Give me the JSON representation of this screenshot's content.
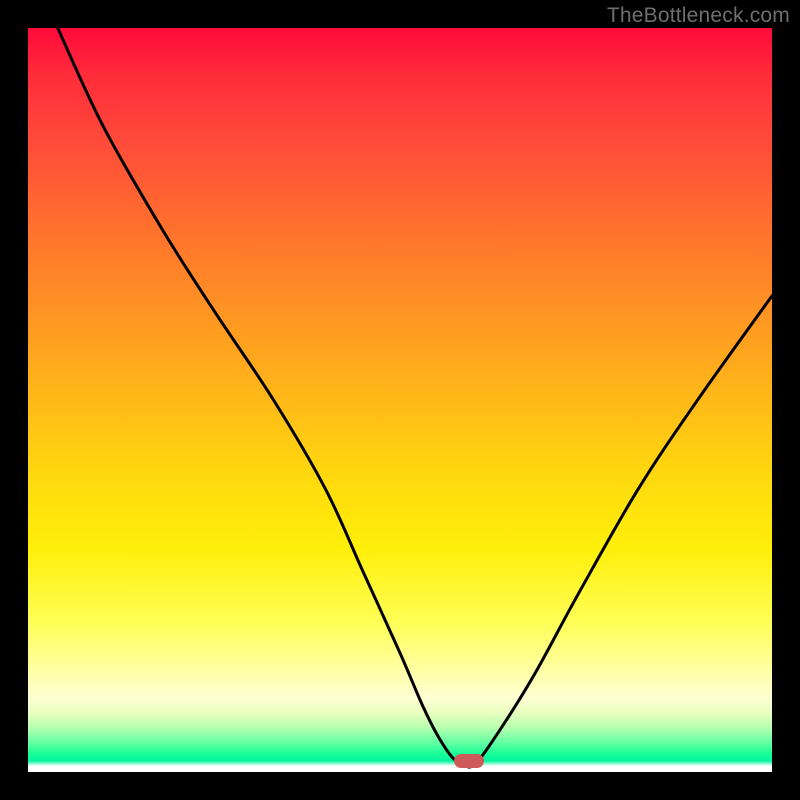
{
  "watermark": "TheBottleneck.com",
  "colors": {
    "curve_stroke": "#000000",
    "marker_fill": "#cf5a5a"
  },
  "chart_data": {
    "type": "line",
    "title": "",
    "xlabel": "",
    "ylabel": "",
    "xlim": [
      0,
      100
    ],
    "ylim": [
      0,
      100
    ],
    "grid": false,
    "legend": false,
    "series": [
      {
        "name": "bottleneck-curve",
        "x": [
          4,
          10,
          18,
          25,
          33,
          40,
          45,
          50,
          53,
          55,
          57,
          58.5,
          60,
          63,
          68,
          74,
          82,
          90,
          100
        ],
        "values": [
          100,
          87,
          73,
          62,
          50,
          38,
          27,
          16,
          9,
          5,
          2,
          1,
          1,
          5,
          13,
          24,
          38,
          50,
          64
        ]
      }
    ],
    "annotations": [
      {
        "type": "marker",
        "shape": "pill",
        "x": 59.3,
        "y": 1.5
      }
    ]
  }
}
